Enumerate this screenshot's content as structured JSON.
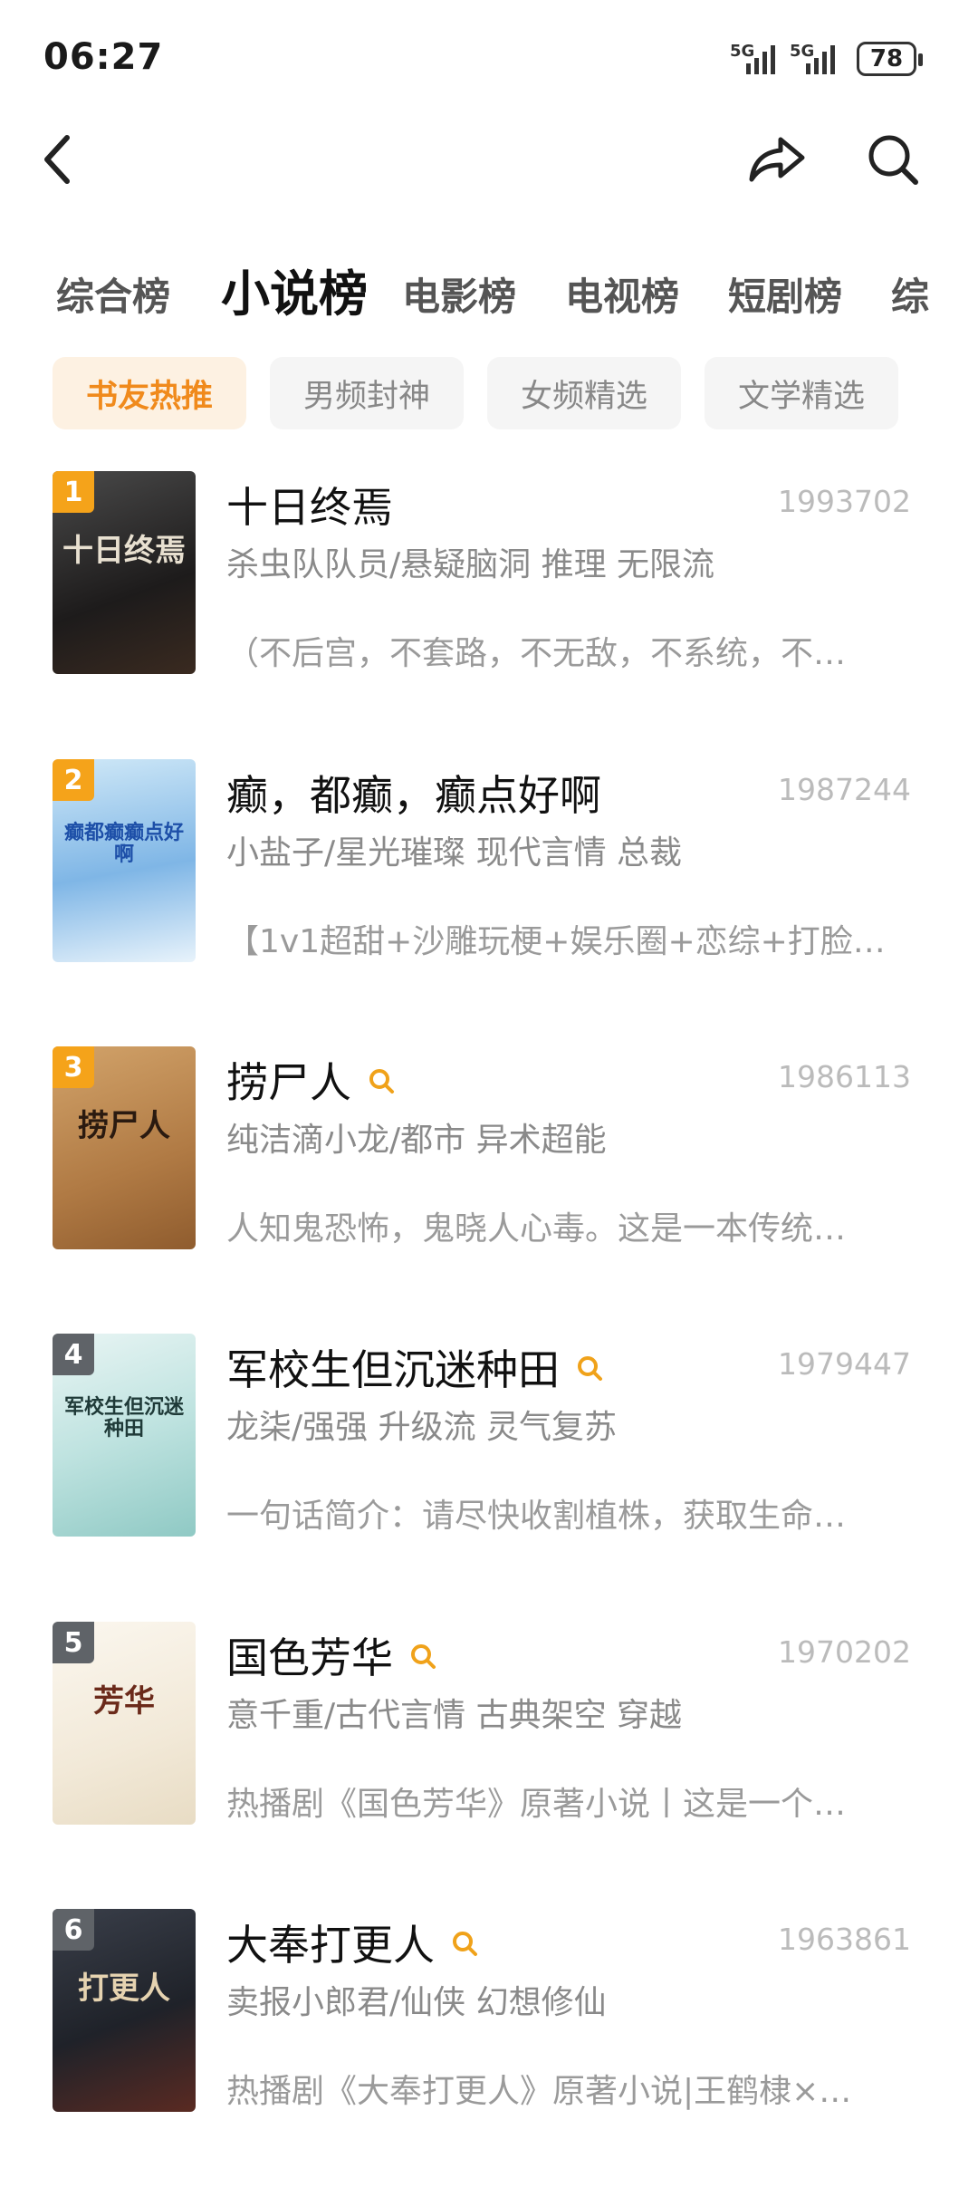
{
  "status": {
    "time": "06:27",
    "network1": "5G",
    "network2": "5G",
    "battery": "78"
  },
  "nav": {
    "back_icon": "chevron-left-icon",
    "share_icon": "share-icon",
    "search_icon": "search-icon"
  },
  "tabs": [
    "综合榜",
    "小说榜",
    "电影榜",
    "电视榜",
    "短剧榜",
    "综"
  ],
  "chips": [
    "书友热推",
    "男频封神",
    "女频精选",
    "文学精选"
  ],
  "colors": {
    "accent": "#f08a1c",
    "chip_active_bg": "#fdf1e2",
    "rank_top": "#f5a31a",
    "rank_other": "#5f6368"
  },
  "books": [
    {
      "rank": "1",
      "title": "十日终焉",
      "score": "1993702",
      "meta": "杀虫队队员/悬疑脑洞 推理 无限流",
      "desc": "（不后宫，不套路，不无敌，不系统，不…",
      "search_badge": false,
      "cover_text": "十日终焉"
    },
    {
      "rank": "2",
      "title": "癫，都癫，癫点好啊",
      "score": "1987244",
      "meta": "小盐子/星光璀璨 现代言情 总裁",
      "desc": "【1v1超甜+沙雕玩梗+娱乐圈+恋综+打脸…",
      "search_badge": false,
      "cover_text": "癫都癫癫点好啊"
    },
    {
      "rank": "3",
      "title": "捞尸人",
      "score": "1986113",
      "meta": "纯洁滴小龙/都市 异术超能",
      "desc": "人知鬼恐怖，鬼晓人心毒。这是一本传统…",
      "search_badge": true,
      "cover_text": "捞尸人"
    },
    {
      "rank": "4",
      "title": "军校生但沉迷种田",
      "score": "1979447",
      "meta": "龙柒/强强 升级流 灵气复苏",
      "desc": "一句话简介：请尽快收割植株，获取生命…",
      "search_badge": true,
      "cover_text": "军校生但沉迷种田"
    },
    {
      "rank": "5",
      "title": "国色芳华",
      "score": "1970202",
      "meta": "意千重/古代言情 古典架空 穿越",
      "desc": "热播剧《国色芳华》原著小说丨这是一个…",
      "search_badge": true,
      "cover_text": "芳华"
    },
    {
      "rank": "6",
      "title": "大奉打更人",
      "score": "1963861",
      "meta": "卖报小郎君/仙侠 幻想修仙",
      "desc": "热播剧《大奉打更人》原著小说|王鹤棣×…",
      "search_badge": true,
      "cover_text": "打更人"
    }
  ]
}
